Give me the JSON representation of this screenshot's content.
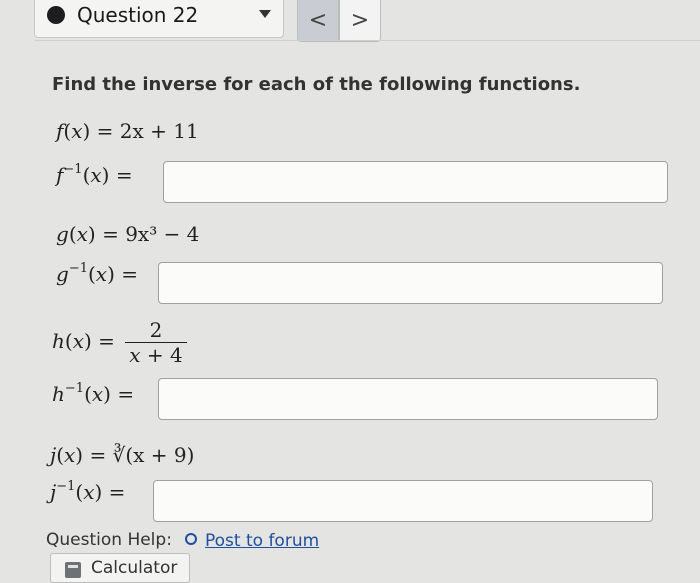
{
  "header": {
    "question_label": "Question 22",
    "prev_glyph": "<",
    "next_glyph": ">"
  },
  "prompt": "Find the inverse for each of the following functions.",
  "problems": [
    {
      "fn": "f",
      "definition": "2x + 11",
      "answer_value": ""
    },
    {
      "fn": "g",
      "definition": "9x³ − 4",
      "answer_value": ""
    },
    {
      "fn": "h",
      "definition": "2 / (x + 4)",
      "answer_value": ""
    },
    {
      "fn": "j",
      "definition": "∛(x + 9)",
      "answer_value": ""
    }
  ],
  "footer": {
    "help_label": "Question Help:",
    "forum_link": "Post to forum",
    "calculator_label": "Calculator"
  },
  "icons": [
    "question-status-dot-icon",
    "dropdown-caret-icon",
    "chevron-left-icon",
    "chevron-right-icon",
    "forum-bubble-icon",
    "calculator-icon"
  ]
}
